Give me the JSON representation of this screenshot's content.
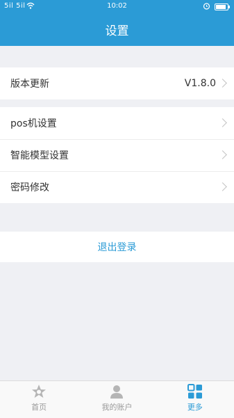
{
  "status_bar": {
    "signal": "5il 5il",
    "time": "10:02",
    "battery_level": 0.85
  },
  "header": {
    "title": "设置"
  },
  "settings": {
    "version_update": {
      "label": "版本更新",
      "value": "V1.8.0"
    },
    "pos_settings": {
      "label": "pos机设置"
    },
    "smart_model_settings": {
      "label": "智能模型设置"
    },
    "password_change": {
      "label": "密码修改"
    }
  },
  "logout": {
    "label": "退出登录"
  },
  "tabbar": {
    "home": "首页",
    "account": "我的账户",
    "more": "更多"
  },
  "colors": {
    "accent": "#2b9bd6",
    "background": "#eff0f4"
  }
}
